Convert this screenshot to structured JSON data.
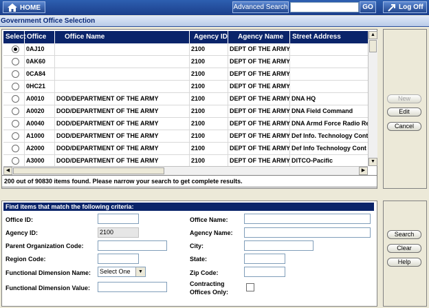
{
  "topbar": {
    "home_label": "HOME",
    "advanced_search_label": "Advanced Search",
    "search_value": "",
    "go_label": "GO",
    "logoff_label": "Log Off"
  },
  "page_title": "Government Office Selection",
  "grid": {
    "columns": [
      "Select",
      "Office ID",
      "Office Name",
      "Agency ID",
      "Agency Name",
      "Street Address"
    ],
    "rows": [
      {
        "selected": true,
        "office_id": "0AJ10",
        "office_name": "",
        "agency_id": "2100",
        "agency_name": "DEPT OF THE ARMY",
        "street": ""
      },
      {
        "selected": false,
        "office_id": "0AK60",
        "office_name": "",
        "agency_id": "2100",
        "agency_name": "DEPT OF THE ARMY",
        "street": ""
      },
      {
        "selected": false,
        "office_id": "0CA84",
        "office_name": "",
        "agency_id": "2100",
        "agency_name": "DEPT OF THE ARMY",
        "street": ""
      },
      {
        "selected": false,
        "office_id": "0HC21",
        "office_name": "",
        "agency_id": "2100",
        "agency_name": "DEPT OF THE ARMY",
        "street": ""
      },
      {
        "selected": false,
        "office_id": "A0010",
        "office_name": "DOD/DEPARTMENT OF THE ARMY",
        "agency_id": "2100",
        "agency_name": "DEPT OF THE ARMY",
        "street": "DNA HQ"
      },
      {
        "selected": false,
        "office_id": "A0020",
        "office_name": "DOD/DEPARTMENT OF THE ARMY",
        "agency_id": "2100",
        "agency_name": "DEPT OF THE ARMY",
        "street": "DNA Field Command"
      },
      {
        "selected": false,
        "office_id": "A0040",
        "office_name": "DOD/DEPARTMENT OF THE ARMY",
        "agency_id": "2100",
        "agency_name": "DEPT OF THE ARMY",
        "street": "DNA Armd Force Radio Re"
      },
      {
        "selected": false,
        "office_id": "A1000",
        "office_name": "DOD/DEPARTMENT OF THE ARMY",
        "agency_id": "2100",
        "agency_name": "DEPT OF THE ARMY",
        "street": "Def Info. Technology Cont"
      },
      {
        "selected": false,
        "office_id": "A2000",
        "office_name": "DOD/DEPARTMENT OF THE ARMY",
        "agency_id": "2100",
        "agency_name": "DEPT OF THE ARMY",
        "street": "Def Info Technology Cont"
      },
      {
        "selected": false,
        "office_id": "A3000",
        "office_name": "DOD/DEPARTMENT OF THE ARMY",
        "agency_id": "2100",
        "agency_name": "DEPT OF THE ARMY",
        "street": "DITCO-Pacific"
      }
    ]
  },
  "status_text": "200 out of 90830 items found. Please narrow your search to get complete results.",
  "side_buttons_top": {
    "new": "New",
    "edit": "Edit",
    "cancel": "Cancel"
  },
  "criteria": {
    "heading": "Find items that match the following criteria:",
    "office_id_label": "Office ID:",
    "office_id_value": "",
    "agency_id_label": "Agency ID:",
    "agency_id_value": "2100",
    "parent_org_label": "Parent Organization Code:",
    "parent_org_value": "",
    "region_label": "Region Code:",
    "region_value": "",
    "func_dim_name_label": "Functional Dimension Name:",
    "func_dim_name_value": "Select One",
    "func_dim_value_label": "Functional Dimension Value:",
    "func_dim_value_value": "",
    "office_name_label": "Office Name:",
    "office_name_value": "",
    "agency_name_label": "Agency Name:",
    "agency_name_value": "",
    "city_label": "City:",
    "city_value": "",
    "state_label": "State:",
    "state_value": "",
    "zip_label": "Zip Code:",
    "zip_value": "",
    "contracting_label_1": "Contracting",
    "contracting_label_2": "Offices Only:",
    "contracting_checked": false
  },
  "side_buttons_bottom": {
    "search": "Search",
    "clear": "Clear",
    "help": "Help"
  }
}
